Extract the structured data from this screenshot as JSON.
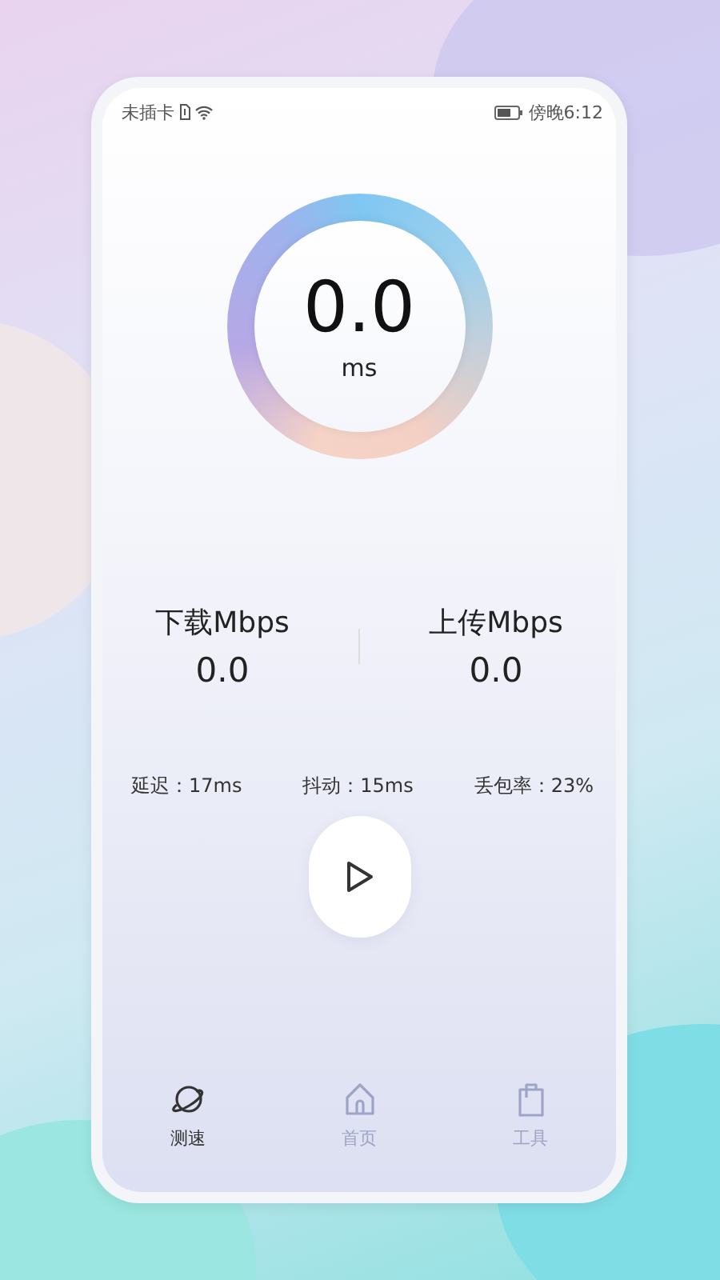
{
  "status_bar": {
    "carrier": "未插卡",
    "time": "傍晚6:12"
  },
  "gauge": {
    "value": "0.0",
    "unit": "ms"
  },
  "speeds": [
    {
      "label": "下载Mbps",
      "value": "0.0"
    },
    {
      "label": "上传Mbps",
      "value": "0.0"
    }
  ],
  "metrics": [
    "延迟：17ms",
    "抖动：15ms",
    "丢包率：23%"
  ],
  "nav": [
    {
      "label": "测速",
      "selected": true
    },
    {
      "label": "首页",
      "selected": false
    },
    {
      "label": "工具",
      "selected": false
    }
  ]
}
